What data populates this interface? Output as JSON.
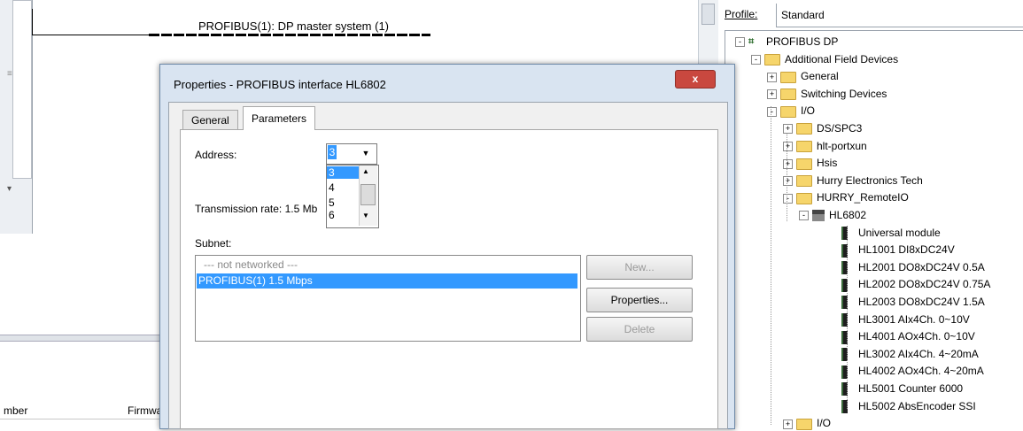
{
  "network": {
    "dp_label": "PROFIBUS(1): DP master system (1)"
  },
  "bottom_table": {
    "columns": [
      "mber",
      "Firmwa"
    ]
  },
  "dialog": {
    "title": "Properties - PROFIBUS interface  HL6802",
    "close_label": "x",
    "tabs": [
      "General",
      "Parameters"
    ],
    "address_label": "Address:",
    "address_value": "3",
    "address_options": [
      "3",
      "4",
      "5",
      "6"
    ],
    "transmission_rate": "Transmission rate: 1.5 Mb",
    "subnet_label": "Subnet:",
    "subnets": [
      "--- not networked ---",
      "PROFIBUS(1)     1.5 Mbps"
    ],
    "buttons": {
      "new": "New...",
      "properties": "Properties...",
      "delete": "Delete"
    }
  },
  "catalog": {
    "profile_label": "Profile:",
    "profile_value": "Standard",
    "tree": [
      {
        "label": "PROFIBUS DP",
        "icon": "profibus-icon",
        "expander": "-"
      },
      {
        "label": "Additional Field Devices",
        "icon": "folder-icon",
        "expander": "-"
      },
      {
        "label": "General",
        "icon": "folder-icon",
        "expander": "+"
      },
      {
        "label": "Switching Devices",
        "icon": "folder-icon",
        "expander": "+"
      },
      {
        "label": "I/O",
        "icon": "folder-icon",
        "expander": "-"
      },
      {
        "label": "DS/SPC3",
        "icon": "folder-icon",
        "expander": "+"
      },
      {
        "label": "hlt-portxun",
        "icon": "folder-icon",
        "expander": "+"
      },
      {
        "label": "Hsis",
        "icon": "folder-icon",
        "expander": "+"
      },
      {
        "label": "Hurry Electronics Tech",
        "icon": "folder-icon",
        "expander": "+"
      },
      {
        "label": "HURRY_RemoteIO",
        "icon": "folder-icon",
        "expander": "-"
      },
      {
        "label": "HL6802",
        "icon": "device-icon",
        "expander": "-"
      },
      {
        "label": "Universal module",
        "icon": "module-icon"
      },
      {
        "label": "HL1001 DI8xDC24V",
        "icon": "module-icon"
      },
      {
        "label": "HL2001 DO8xDC24V 0.5A",
        "icon": "module-icon"
      },
      {
        "label": "HL2002 DO8xDC24V 0.75A",
        "icon": "module-icon"
      },
      {
        "label": "HL2003 DO8xDC24V 1.5A",
        "icon": "module-icon"
      },
      {
        "label": "HL3001 AIx4Ch. 0~10V",
        "icon": "module-icon"
      },
      {
        "label": "HL4001 AOx4Ch. 0~10V",
        "icon": "module-icon"
      },
      {
        "label": "HL3002 AIx4Ch. 4~20mA",
        "icon": "module-icon"
      },
      {
        "label": "HL4002 AOx4Ch. 4~20mA",
        "icon": "module-icon"
      },
      {
        "label": "HL5001 Counter 6000",
        "icon": "module-icon"
      },
      {
        "label": "HL5002 AbsEncoder SSI",
        "icon": "module-icon"
      },
      {
        "label": "I/O",
        "icon": "folder-icon",
        "expander": "+"
      }
    ]
  }
}
